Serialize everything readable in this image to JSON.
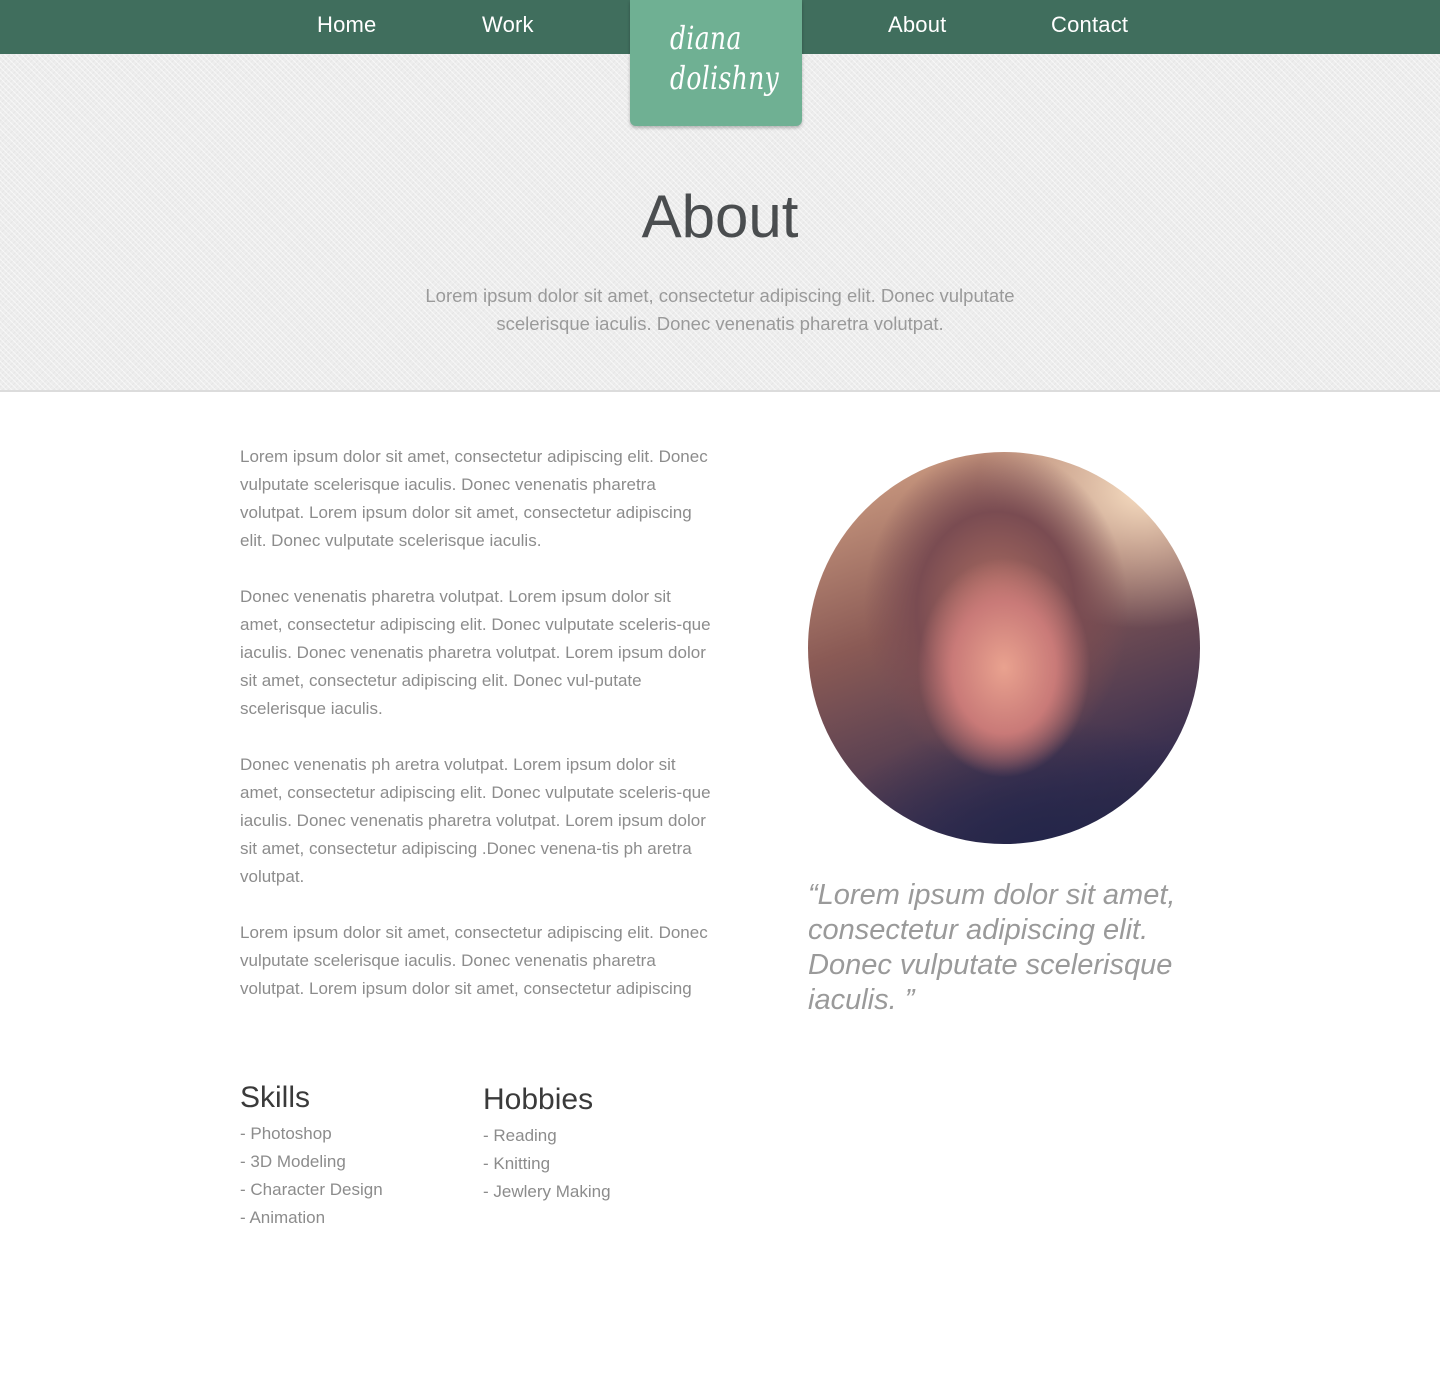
{
  "nav": {
    "items": [
      "Home",
      "Work",
      "About",
      "Contact"
    ],
    "logo_line1": "diana",
    "logo_line2": "dolishny"
  },
  "hero": {
    "title": "About",
    "intro": "Lorem ipsum dolor sit amet, consectetur adipiscing elit. Donec vulputate scelerisque iaculis. Donec venenatis pharetra volutpat."
  },
  "content": {
    "paragraphs": [
      "Lorem ipsum dolor sit amet, consectetur adipiscing elit. Donec vulputate scelerisque iaculis. Donec venenatis pharetra volutpat. Lorem ipsum dolor sit amet, consectetur adipiscing elit. Donec vulputate scelerisque iaculis.",
      "Donec venenatis pharetra volutpat. Lorem ipsum dolor sit amet, consectetur adipiscing elit. Donec vulputate sceleris-que iaculis. Donec venenatis pharetra volutpat. Lorem ipsum dolor sit amet, consectetur adipiscing elit. Donec vul-putate scelerisque iaculis.",
      "Donec venenatis ph aretra volutpat. Lorem ipsum dolor sit amet, consectetur adipiscing elit. Donec vulputate sceleris-que iaculis. Donec venenatis pharetra volutpat. Lorem ipsum dolor sit amet, consectetur adipiscing .Donec venena-tis ph aretra volutpat.",
      "Lorem ipsum dolor sit amet, consectetur adipiscing elit. Donec vulputate scelerisque iaculis. Donec venenatis pharetra volutpat. Lorem ipsum dolor sit amet, consectetur adipiscing"
    ],
    "quote": "“Lorem ipsum dolor sit amet, consectetur adipiscing elit. Donec vulputate scelerisque iaculis. ”"
  },
  "skills": {
    "heading": "Skills",
    "items": [
      "- Photoshop",
      "- 3D Modeling",
      "- Character Design",
      "- Animation"
    ]
  },
  "hobbies": {
    "heading": "Hobbies",
    "items": [
      "- Reading",
      "- Knitting",
      "- Jewlery Making"
    ]
  },
  "colors": {
    "nav_bg": "#406e5d",
    "logo_bg": "#6fb093",
    "hero_bg": "#ededed",
    "heading": "#4a4d4f",
    "body_text": "#8c8c8c"
  },
  "icons": {
    "portrait": "profile-photo"
  }
}
